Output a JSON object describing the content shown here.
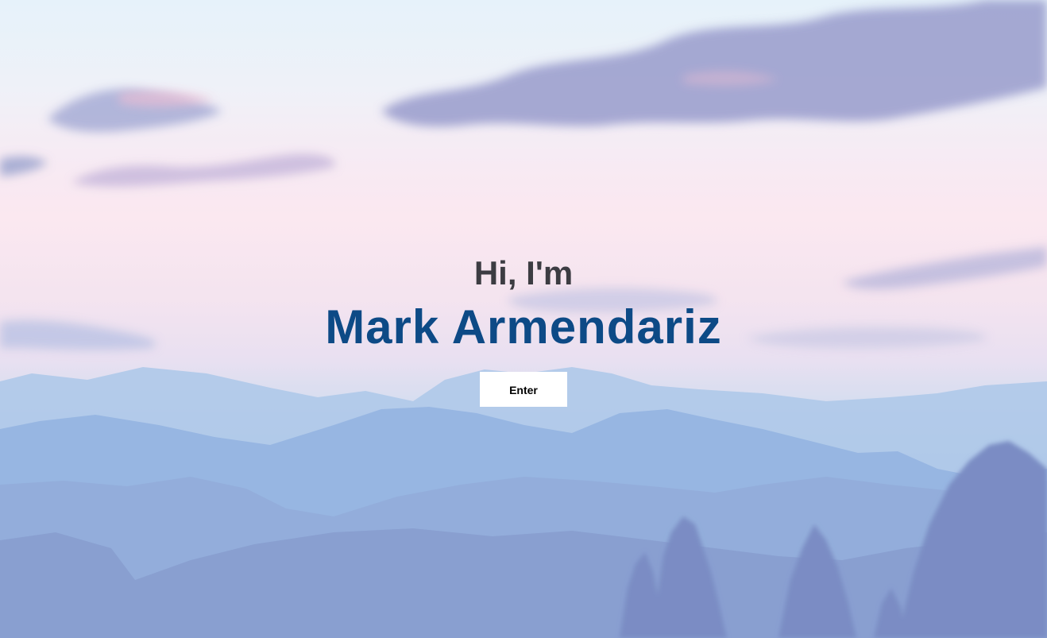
{
  "hero": {
    "greeting": "Hi, I'm",
    "name": "Mark Armendariz",
    "enter_label": "Enter"
  },
  "colors": {
    "greeting_text": "#3c3c42",
    "name_text": "#0d4a86",
    "button_bg": "#ffffff",
    "button_text": "#000000"
  }
}
